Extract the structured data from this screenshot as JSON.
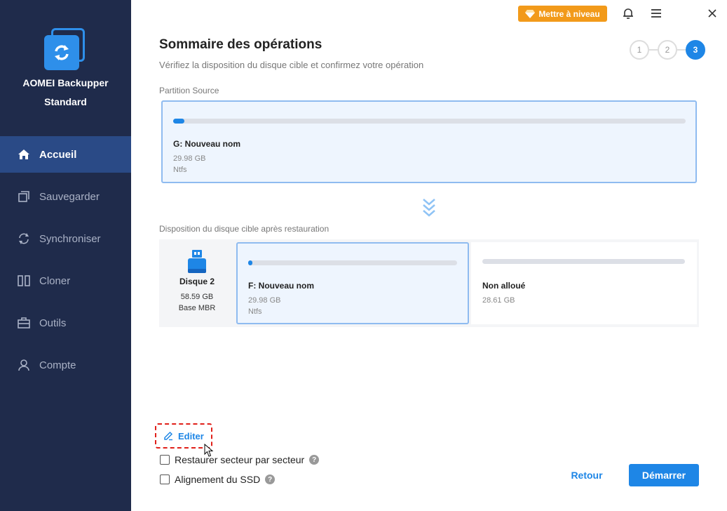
{
  "app": {
    "name": "AOMEI Backupper",
    "edition": "Standard"
  },
  "sidebar": {
    "items": [
      {
        "label": "Accueil",
        "icon": "home-icon",
        "active": true
      },
      {
        "label": "Sauvegarder",
        "icon": "backup-icon",
        "active": false
      },
      {
        "label": "Synchroniser",
        "icon": "sync-icon",
        "active": false
      },
      {
        "label": "Cloner",
        "icon": "clone-icon",
        "active": false
      },
      {
        "label": "Outils",
        "icon": "tools-icon",
        "active": false
      },
      {
        "label": "Compte",
        "icon": "user-icon",
        "active": false
      }
    ]
  },
  "topbar": {
    "upgrade_label": "Mettre à niveau"
  },
  "header": {
    "title": "Sommaire des opérations",
    "subtitle": "Vérifiez la disposition du disque cible et confirmez votre opération",
    "steps": [
      "1",
      "2",
      "3"
    ],
    "active_step": 3
  },
  "source": {
    "section_label": "Partition Source",
    "partition": {
      "name": "G: Nouveau nom",
      "size": "29.98 GB",
      "fs": "Ntfs",
      "used_fraction": 0.02
    }
  },
  "target": {
    "section_label": "Disposition du disque cible après restauration",
    "disk": {
      "label": "Disque 2",
      "size": "58.59 GB",
      "type": "Base MBR"
    },
    "partitions": [
      {
        "name": "F: Nouveau nom",
        "size": "29.98 GB",
        "fs": "Ntfs",
        "used_fraction": 0.02
      },
      {
        "name": "Non alloué",
        "size": "28.61 GB",
        "used_fraction": 0
      }
    ]
  },
  "bottom": {
    "edit_label": "Editer",
    "options": [
      {
        "label": "Restaurer secteur par secteur",
        "checked": false
      },
      {
        "label": "Alignement du SSD",
        "checked": false
      }
    ],
    "help_glyph": "?",
    "back_label": "Retour",
    "start_label": "Démarrer"
  },
  "colors": {
    "accent": "#1e86e6",
    "sidebar": "#1f2b4b",
    "upgrade": "#f29a1a",
    "highlight": "#e0201a"
  }
}
